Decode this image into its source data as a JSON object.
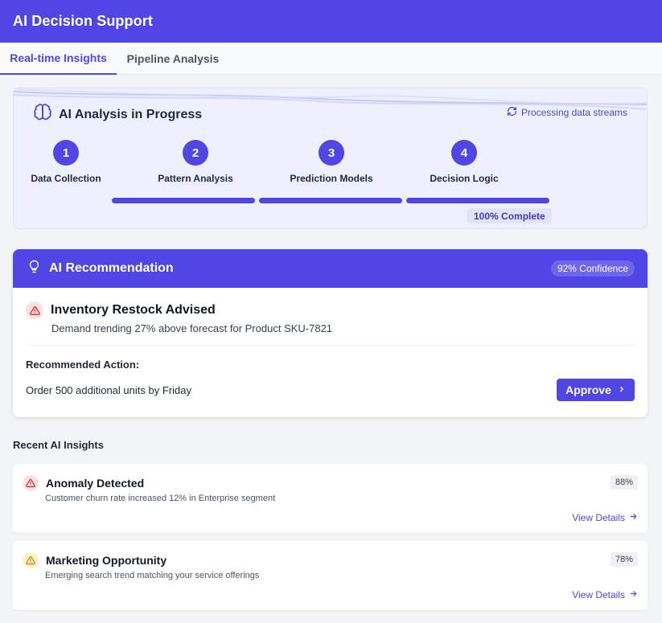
{
  "app": {
    "title": "AI Decision Support"
  },
  "tabs": [
    {
      "label": "Real-time Insights",
      "active": true
    },
    {
      "label": "Pipeline Analysis",
      "active": false
    }
  ],
  "analysis": {
    "title": "AI Analysis in Progress",
    "status": "Processing data streams",
    "steps": [
      {
        "number": "1",
        "label": "Data Collection"
      },
      {
        "number": "2",
        "label": "Pattern Analysis"
      },
      {
        "number": "3",
        "label": "Prediction Models"
      },
      {
        "number": "4",
        "label": "Decision Logic"
      }
    ],
    "progress_percent": 100,
    "complete_label": "100% Complete"
  },
  "recommendation": {
    "header": "AI Recommendation",
    "confidence": "92% Confidence",
    "title": "Inventory Restock Advised",
    "description": "Demand trending 27% above forecast for Product SKU-7821",
    "action_label": "Recommended Action:",
    "action": "Order 500 additional units by Friday",
    "approve_label": "Approve"
  },
  "recent": {
    "title": "Recent AI Insights",
    "items": [
      {
        "title": "Anomaly Detected",
        "description": "Customer churn rate increased 12% in Enterprise segment",
        "score": "88%",
        "link": "View Details",
        "severity": "red"
      },
      {
        "title": "Marketing Opportunity",
        "description": "Emerging search trend matching your service offerings",
        "score": "78%",
        "link": "View Details",
        "severity": "yellow"
      }
    ]
  },
  "colors": {
    "primary": "#4f46e5",
    "alert_red": "#dc2626",
    "alert_yellow": "#d97706"
  },
  "icons": {
    "analysis": "brain-icon",
    "status": "refresh-icon",
    "recommendation": "lightbulb-icon",
    "alert": "warning-icon",
    "chevron": "chevron-right-icon",
    "arrow": "arrow-right-icon"
  }
}
